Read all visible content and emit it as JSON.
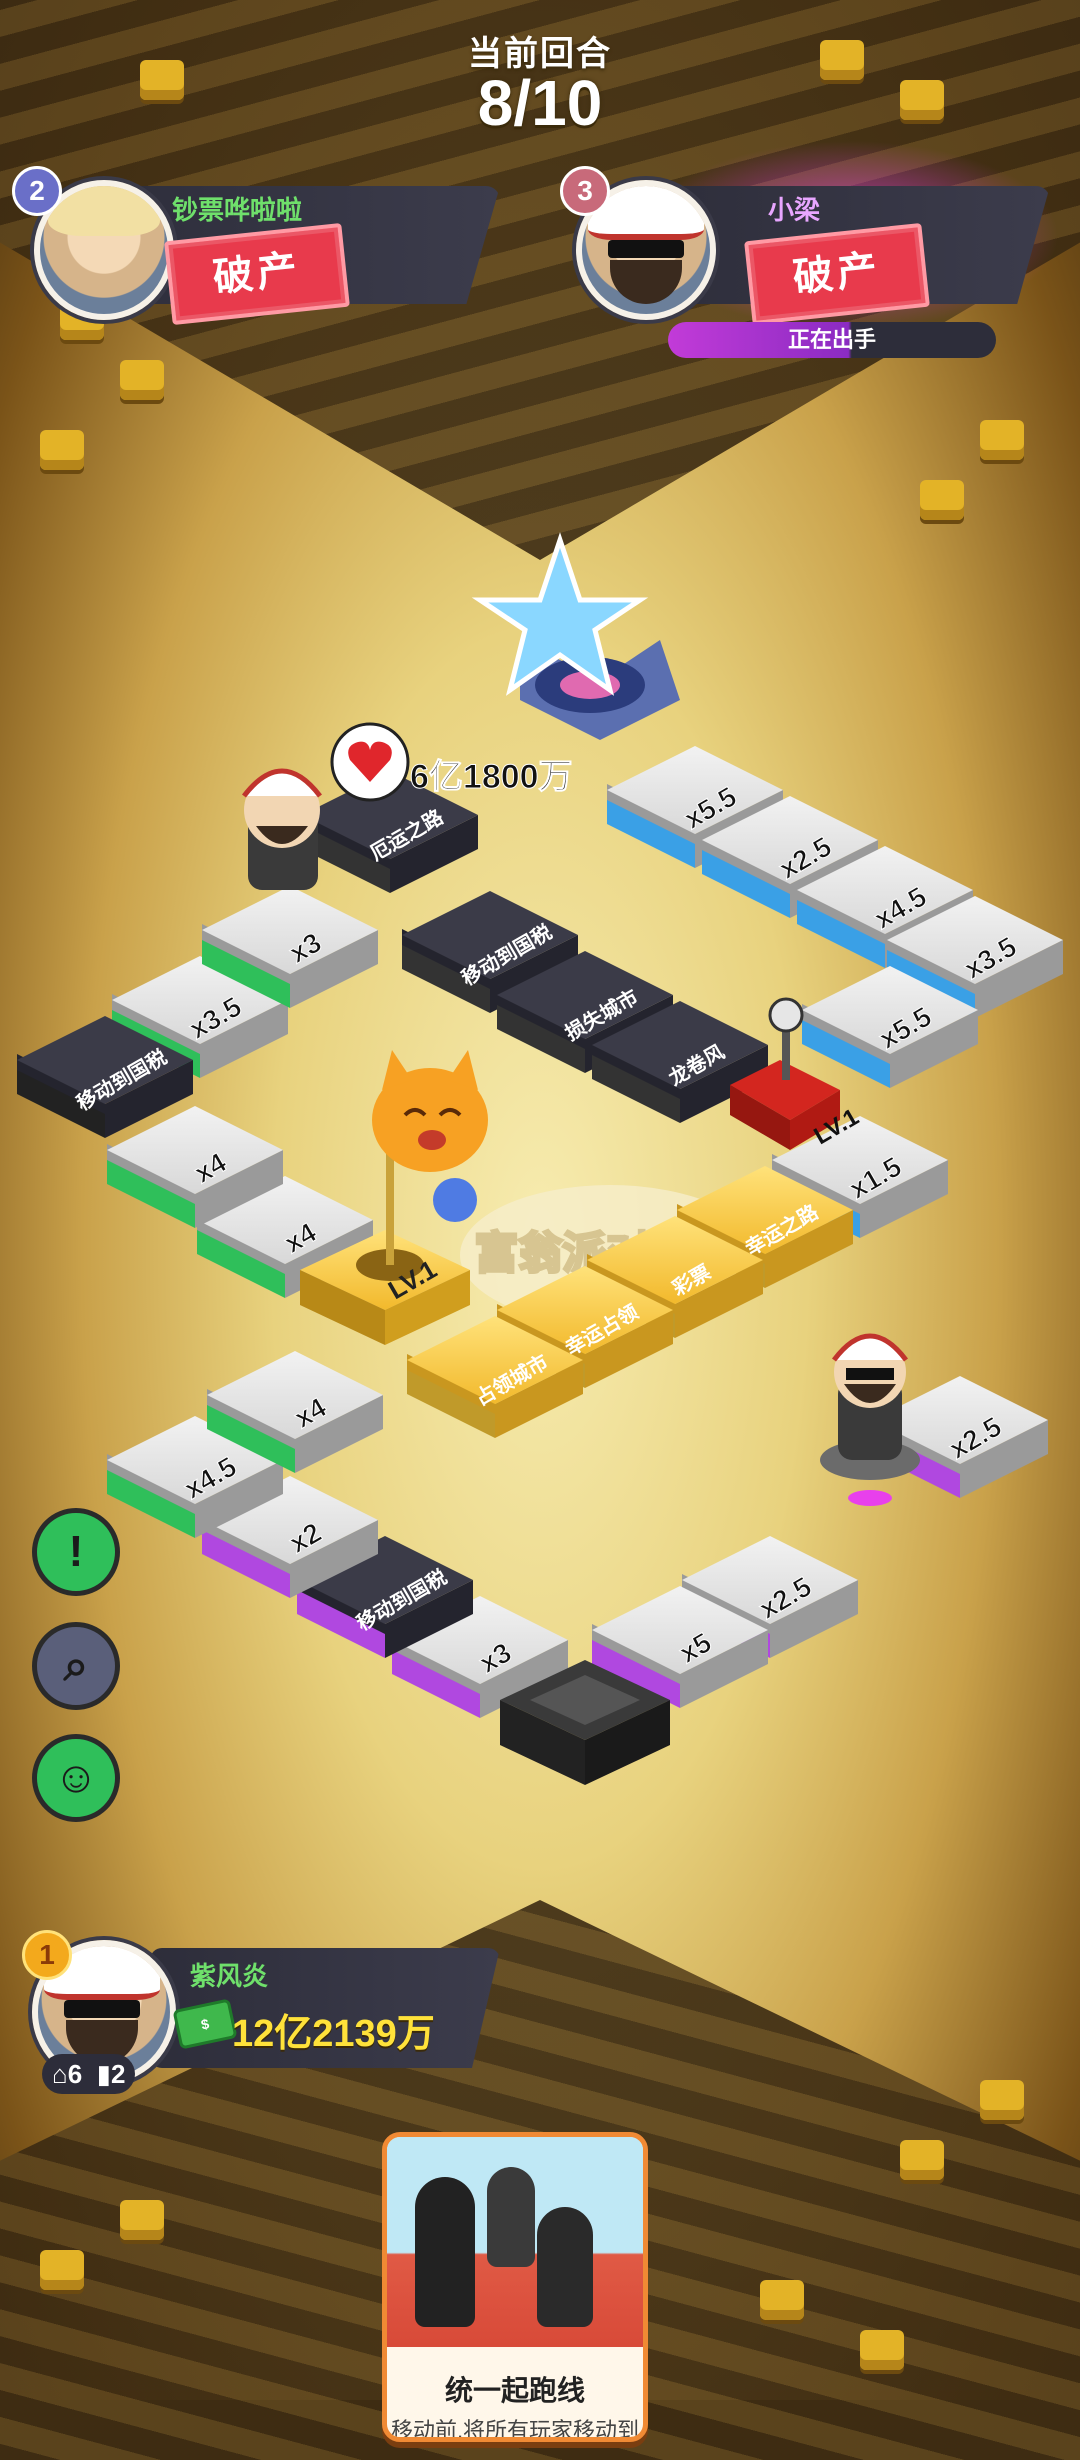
{
  "header": {
    "round_label": "当前回合",
    "round_value": "8/10"
  },
  "players": [
    {
      "rank": "2",
      "name": "钞票哗啦啦",
      "status": "破产",
      "rank_color": "#6a6fc8"
    },
    {
      "rank": "3",
      "name": "小梁",
      "status": "破产",
      "rank_color": "#c86a7a",
      "turn_text": "正在出手",
      "highlight": "#e840ec"
    }
  ],
  "board": {
    "speech_amount": "6亿1800万",
    "center_logo": "富翁派对 GO!",
    "tiles": [
      {
        "label": "x5.5"
      },
      {
        "label": "x2.5"
      },
      {
        "label": "x4.5"
      },
      {
        "label": "x3.5"
      },
      {
        "label": "x5.5"
      },
      {
        "label": "x1.5"
      },
      {
        "label": "幸运之路"
      },
      {
        "label": "彩票"
      },
      {
        "label": "幸运占领"
      },
      {
        "label": "占领城市"
      },
      {
        "label": "x2.5"
      },
      {
        "label": "x5"
      },
      {
        "label": "x2.5"
      },
      {
        "label": "x3"
      },
      {
        "label": "移动到国税"
      },
      {
        "label": "x2"
      },
      {
        "label": "x4.5"
      },
      {
        "label": "x4"
      },
      {
        "label": "x4"
      },
      {
        "label": "x4"
      },
      {
        "label": "x3.5"
      },
      {
        "label": "移动到国税"
      },
      {
        "label": "x3"
      },
      {
        "label": "厄运之路"
      },
      {
        "label": "移动到国税"
      },
      {
        "label": "损失城市"
      },
      {
        "label": "龙卷风"
      }
    ],
    "level_labels": [
      "LV.1",
      "LV.1"
    ]
  },
  "side_buttons": [
    {
      "icon": "exclamation-icon",
      "glyph": "!"
    },
    {
      "icon": "magnifier-icon",
      "glyph": "⌕"
    },
    {
      "icon": "emoji-icon",
      "glyph": "☺"
    }
  ],
  "me": {
    "rank": "1",
    "name": "紫风炎",
    "money_icon_text": "$",
    "money": "12亿2139万",
    "houses": "6",
    "cards": "2"
  },
  "card": {
    "title": "统一起跑线",
    "desc": "移动前,将所有玩家移动到"
  },
  "colors": {
    "green_row": "#2fbf5a",
    "blue_row": "#3aa0e6",
    "purple_row": "#b048e0",
    "gold": "#f3c43a"
  }
}
